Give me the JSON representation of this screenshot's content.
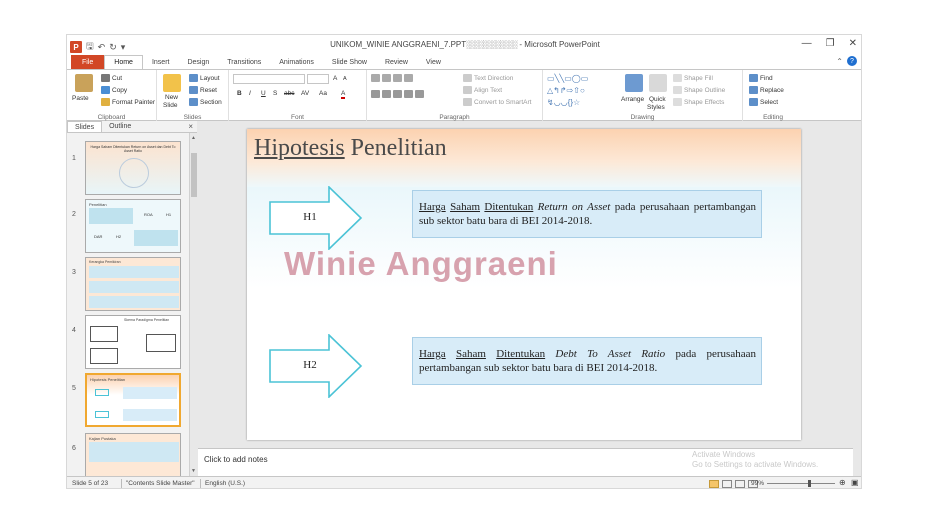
{
  "window": {
    "title": "UNIKOM_WINIE ANGGRAENI_7.PPT░░░░░░░░░ - Microsoft PowerPoint",
    "app_letter": "P",
    "controls": [
      "—",
      "❐",
      "✕"
    ]
  },
  "tabs": [
    "File",
    "Home",
    "Insert",
    "Design",
    "Transitions",
    "Animations",
    "Slide Show",
    "Review",
    "View"
  ],
  "active_tab": "Home",
  "ribbon": {
    "clipboard": {
      "label": "Clipboard",
      "paste": "Paste",
      "cut": "Cut",
      "copy": "Copy",
      "format_painter": "Format Painter"
    },
    "slides": {
      "label": "Slides",
      "new_slide": "New",
      "new_slide2": "Slide",
      "layout": "Layout",
      "reset": "Reset",
      "section": "Section"
    },
    "font": {
      "label": "Font",
      "bold": "B",
      "italic": "I",
      "underline": "U",
      "shadow": "S",
      "strike": "abc",
      "spacing": "AV",
      "case": "Aa",
      "color": "A",
      "grow": "A",
      "shrink": "A"
    },
    "paragraph": {
      "label": "Paragraph",
      "text_direction": "Text Direction",
      "align_text": "Align Text",
      "smartart": "Convert to SmartArt"
    },
    "drawing": {
      "label": "Drawing",
      "arrange": "Arrange",
      "quick_styles": "Quick",
      "quick_styles2": "Styles",
      "shape_fill": "Shape Fill",
      "shape_outline": "Shape Outline",
      "shape_effects": "Shape Effects"
    },
    "editing": {
      "label": "Editing",
      "find": "Find",
      "replace": "Replace",
      "select": "Select"
    }
  },
  "pane": {
    "tabs": [
      "Slides",
      "Outline"
    ],
    "close": "×"
  },
  "thumbnails": [
    {
      "num": "1",
      "title": "Harga Saham Ditentukan Return on Asset dan Debt To Asset Ratio"
    },
    {
      "num": "2",
      "title": "Penelitian",
      "labels": [
        "ROA",
        "H1",
        "DAR",
        "H2"
      ]
    },
    {
      "num": "3",
      "title": "Kerangka Pemikiran"
    },
    {
      "num": "4",
      "title": "Skema Paradigma Penelitian"
    },
    {
      "num": "5",
      "title": "Hipotesis Penelitian"
    },
    {
      "num": "6",
      "title": "Kajian Pustaka"
    }
  ],
  "slide": {
    "title_underlined": "Hipotesis",
    "title_rest": " Penelitian",
    "h1_label": "H1",
    "h2_label": "H2",
    "h1": {
      "u1": "Harga",
      "u2": "Saham",
      "u3": "Ditentukan",
      "italic": "Return on Asset",
      "rest": " pada perusahaan pertambangan  sub sektor batu bara di BEI 2014-2018."
    },
    "h2": {
      "u1": "Harga",
      "u2": "Saham",
      "u3": "Ditentukan",
      "italic": "Debt To Asset Ratio",
      "rest": " pada perusahaan pertambangan  sub sektor batu bara di BEI 2014-2018."
    },
    "watermark": "Winie Anggraeni"
  },
  "notes": {
    "placeholder": "Click to add notes",
    "activate_line1": "Activate Windows",
    "activate_line2": "Go to Settings to activate Windows."
  },
  "status": {
    "slide_count": "Slide 5 of 23",
    "theme": "\"Contents Slide Master\"",
    "language": "English (U.S.)",
    "zoom": "99%"
  },
  "colors": {
    "accent": "#d24726",
    "arrow_outline": "#4bc3d6",
    "hbox_fill": "#d8ecf8",
    "watermark": "#d7a2ae"
  }
}
